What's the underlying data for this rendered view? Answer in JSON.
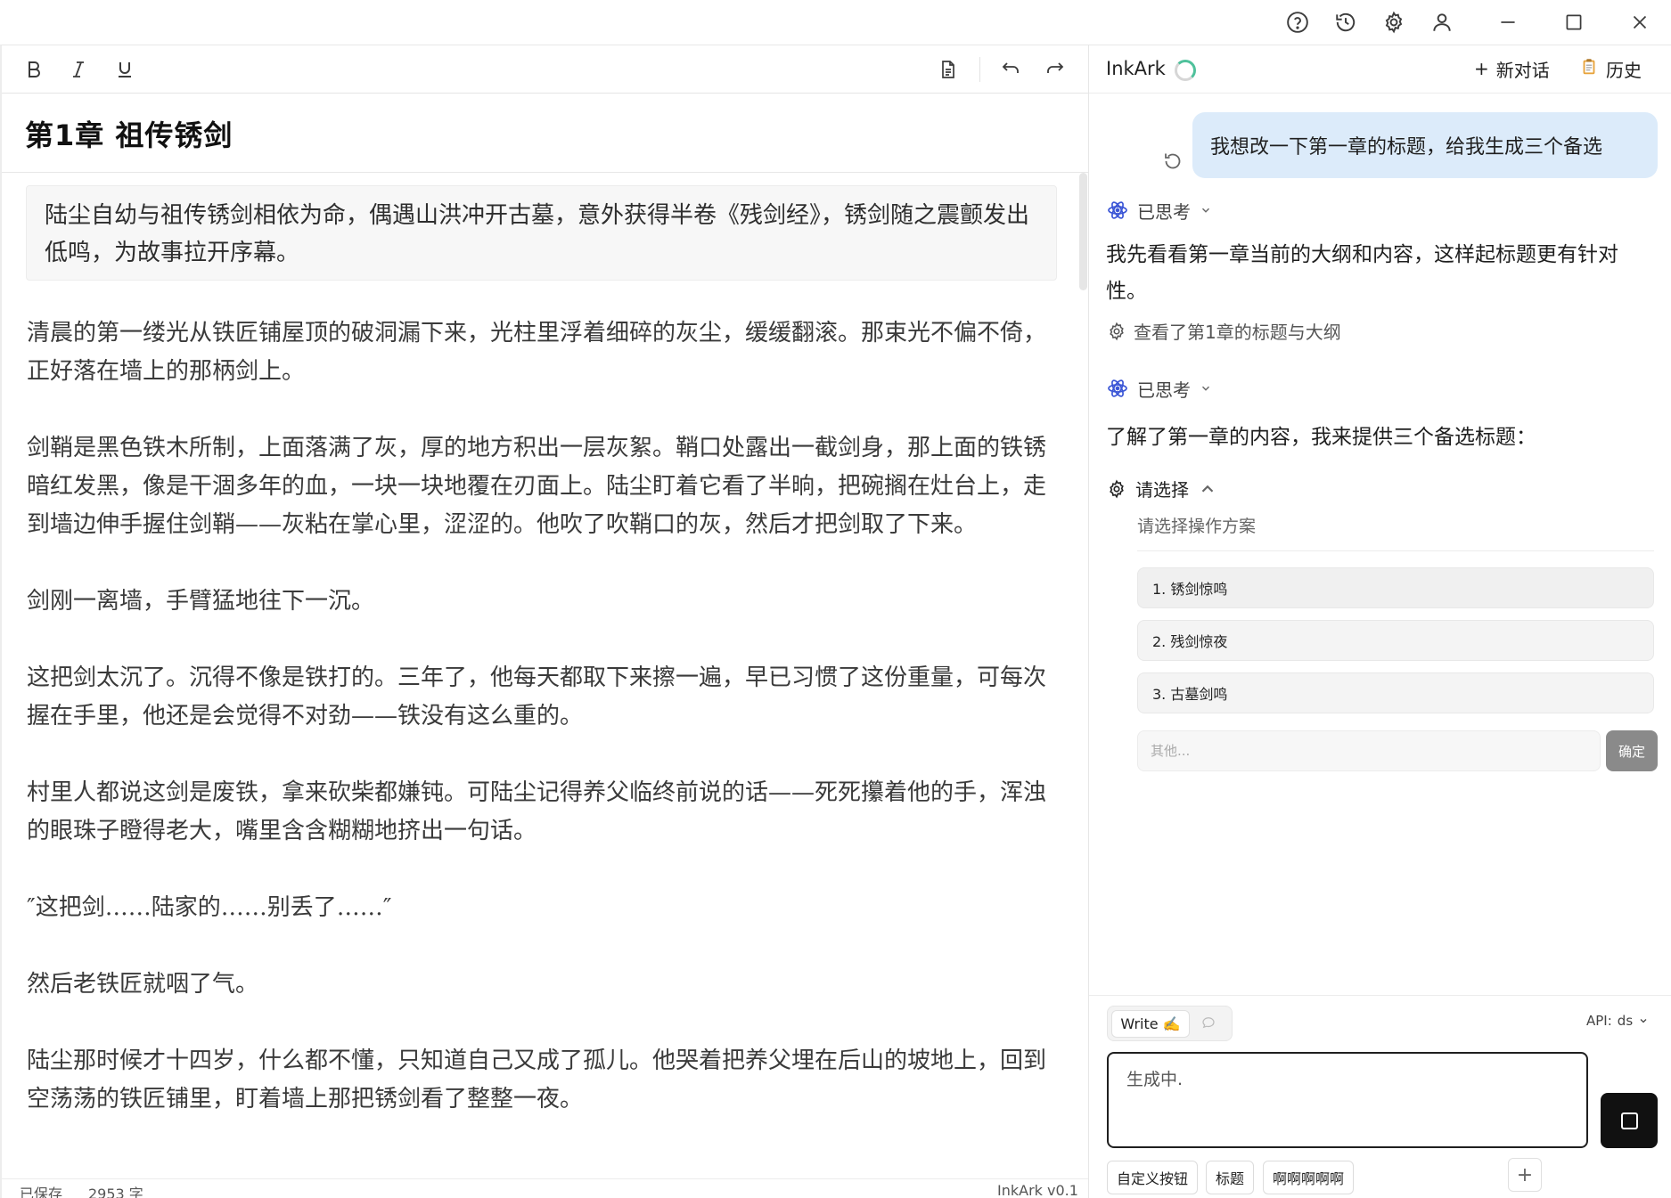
{
  "titlebar": {
    "icons": [
      "help-icon",
      "history-icon",
      "settings-icon",
      "user-icon",
      "minimize-icon",
      "maximize-icon",
      "close-icon"
    ]
  },
  "editor": {
    "toolbar": {
      "bold": "B",
      "italic": "I",
      "underline": "U",
      "icons": [
        "document-icon",
        "undo-icon",
        "redo-icon"
      ]
    },
    "chapter_title": "第1章  祖传锈剑",
    "summary": "陆尘自幼与祖传锈剑相依为命，偶遇山洪冲开古墓，意外获得半卷《残剑经》，锈剑随之震颤发出低鸣，为故事拉开序幕。",
    "paragraphs": [
      "清晨的第一缕光从铁匠铺屋顶的破洞漏下来，光柱里浮着细碎的灰尘，缓缓翻滚。那束光不偏不倚，正好落在墙上的那柄剑上。",
      "剑鞘是黑色铁木所制，上面落满了灰，厚的地方积出一层灰絮。鞘口处露出一截剑身，那上面的铁锈暗红发黑，像是干涸多年的血，一块一块地覆在刃面上。陆尘盯着它看了半晌，把碗搁在灶台上，走到墙边伸手握住剑鞘——灰粘在掌心里，涩涩的。他吹了吹鞘口的灰，然后才把剑取了下来。",
      "剑刚一离墙，手臂猛地往下一沉。",
      "这把剑太沉了。沉得不像是铁打的。三年了，他每天都取下来擦一遍，早已习惯了这份重量，可每次握在手里，他还是会觉得不对劲——铁没有这么重的。",
      "村里人都说这剑是废铁，拿来砍柴都嫌钝。可陆尘记得养父临终前说的话——死死攥着他的手，浑浊的眼珠子瞪得老大，嘴里含含糊糊地挤出一句话。",
      "″这把剑……陆家的……别丢了……″",
      "然后老铁匠就咽了气。",
      "陆尘那时候才十四岁，什么都不懂，只知道自己又成了孤儿。他哭着把养父埋在后山的坡地上，回到空荡荡的铁匠铺里，盯着墙上那把锈剑看了整整一夜。"
    ],
    "status": {
      "saved": "已保存",
      "word_count": "2953 字",
      "version": "InkArk v0.1"
    }
  },
  "chat": {
    "header": {
      "app_name": "InkArk",
      "new_chat": "新对话",
      "history": "历史"
    },
    "user_message": "我想改一下第一章的标题，给我生成三个备选",
    "thought_label": "已思考",
    "ai_message_1": "我先看看第一章当前的大纲和内容，这样起标题更有针对性。",
    "tool_call": "查看了第1章的标题与大纲",
    "ai_message_2": "了解了第一章的内容，我来提供三个备选标题：",
    "choice": {
      "title": "请选择",
      "subtitle": "请选择操作方案",
      "options": [
        "1. 锈剑惊鸣",
        "2. 残剑惊夜",
        "3. 古墓剑鸣"
      ],
      "other_placeholder": "其他...",
      "confirm": "确定"
    },
    "composer": {
      "mode_write": "Write ✍️",
      "api_label": "API:",
      "api_value": "ds",
      "input_placeholder": "生成中.",
      "quick_buttons": [
        "自定义按钮",
        "标题",
        "啊啊啊啊啊"
      ],
      "add_label": "+"
    }
  },
  "colors": {
    "user_bubble": "#dcebfa",
    "accent_blue": "#3b56d6",
    "spinner_green": "#4fc19b",
    "confirm_gray": "#8a8a8a"
  }
}
